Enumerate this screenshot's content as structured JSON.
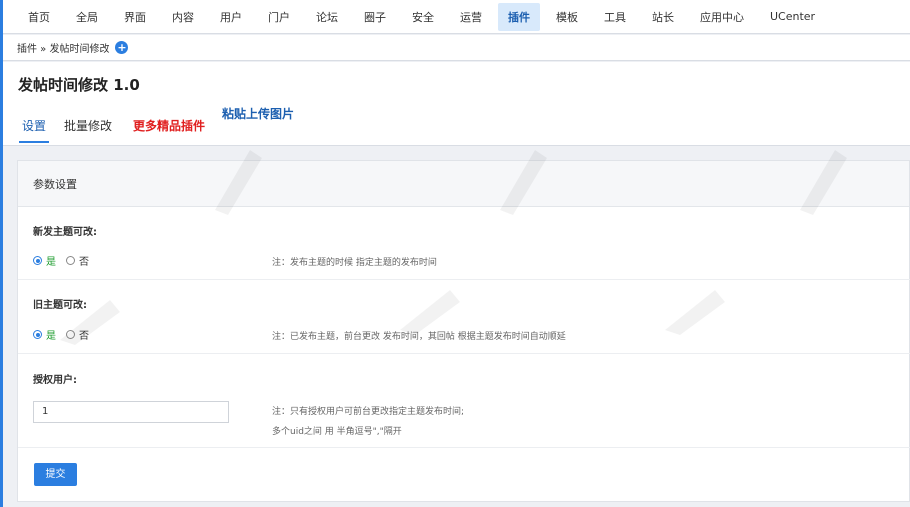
{
  "topnav": {
    "items": [
      "首页",
      "全局",
      "界面",
      "内容",
      "用户",
      "门户",
      "论坛",
      "圈子",
      "安全",
      "运营",
      "插件",
      "模板",
      "工具",
      "站长",
      "应用中心",
      "UCenter"
    ],
    "active_index": 10
  },
  "breadcrumb": {
    "text": "插件 » 发帖时间修改",
    "add_icon": "+"
  },
  "page": {
    "title": "发帖时间修改 1.0"
  },
  "tabs": {
    "settings": "设置",
    "batch": "批量修改",
    "more_plugins": "更多精品插件",
    "paste_upload": "粘贴上传图片"
  },
  "panel": {
    "heading": "参数设置",
    "new_thread": {
      "label": "新发主题可改:",
      "yes": "是",
      "no": "否",
      "selected": "是",
      "note": "注：发布主题的时候 指定主题的发布时间"
    },
    "old_thread": {
      "label": "旧主题可改:",
      "yes": "是",
      "no": "否",
      "selected": "是",
      "note": "注：已发布主题，前台更改 发布时间，其回帖 根据主题发布时间自动顺延"
    },
    "authorized": {
      "label": "授权用户:",
      "value": "1",
      "note_line1": "注：只有授权用户可前台更改指定主题发布时间;",
      "note_line2": "多个uid之间 用 半角逗号\",\"隔开"
    },
    "submit_label": "提交"
  },
  "colors": {
    "accent": "#2b7ee0",
    "more_plugins": "#e02020",
    "yes_green": "#1a9b2b"
  }
}
